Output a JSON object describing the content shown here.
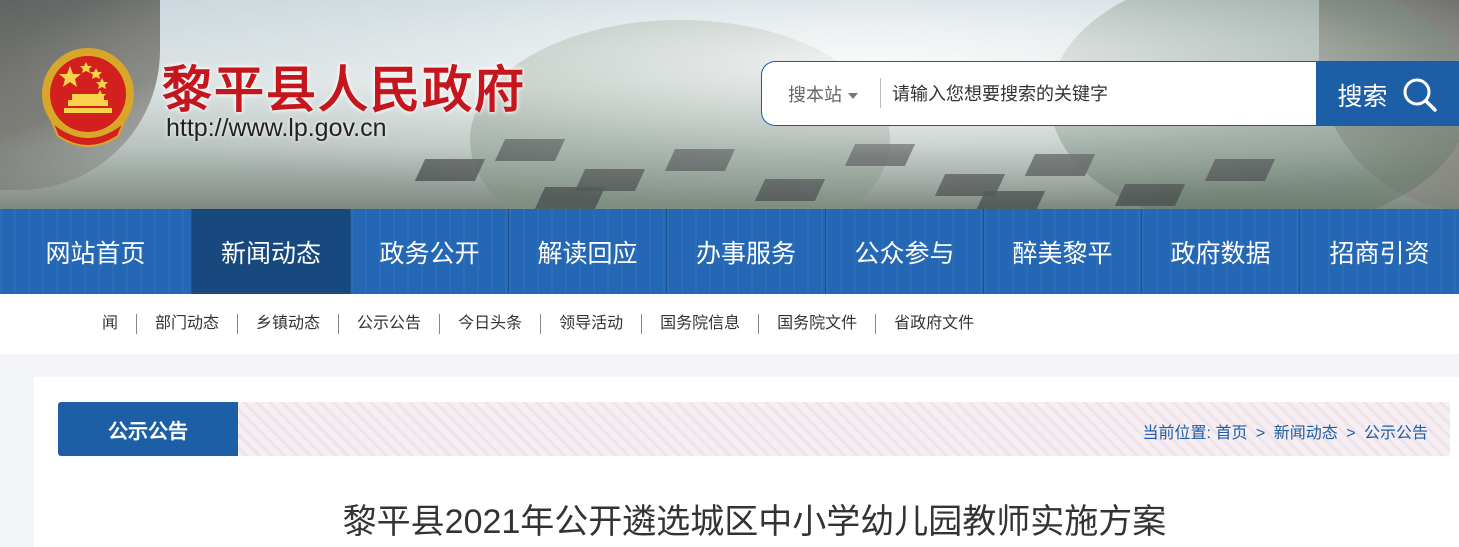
{
  "header": {
    "site_title": "黎平县人民政府",
    "site_url": "http://www.lp.gov.cn",
    "emblem_icon": "national-emblem-icon"
  },
  "search": {
    "scope_label": "搜本站",
    "placeholder": "请输入您想要搜索的关键字",
    "button_label": "搜索",
    "button_icon": "search-icon"
  },
  "nav": {
    "items": [
      "网站首页",
      "新闻动态",
      "政务公开",
      "解读回应",
      "办事服务",
      "公众参与",
      "醉美黎平",
      "政府数据",
      "招商引资"
    ],
    "active_index": 1
  },
  "subnav": {
    "items": [
      "闻",
      "部门动态",
      "乡镇动态",
      "公示公告",
      "今日头条",
      "领导活动",
      "国务院信息",
      "国务院文件",
      "省政府文件"
    ]
  },
  "section": {
    "tag_label": "公示公告",
    "breadcrumb_prefix": "当前位置:",
    "crumbs": [
      "首页",
      "新闻动态",
      "公示公告"
    ],
    "separator": ">"
  },
  "article": {
    "title": "黎平县2021年公开遴选城区中小学幼儿园教师实施方案"
  },
  "colors": {
    "brand_blue": "#2467b4",
    "active_nav": "#17497f",
    "title_red": "#c4161c"
  }
}
